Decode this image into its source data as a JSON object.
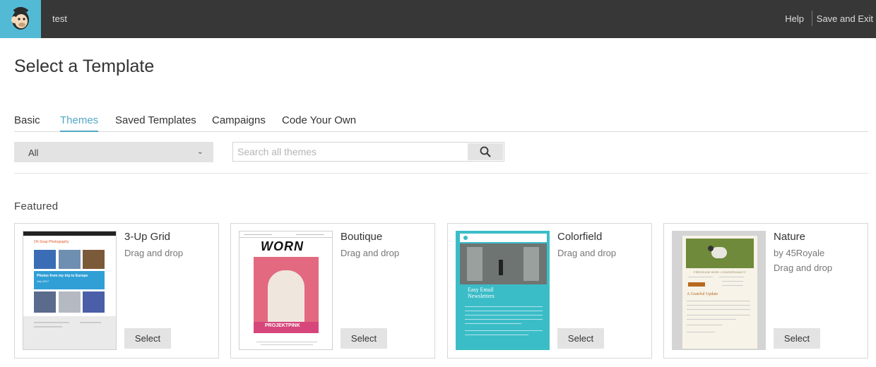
{
  "header": {
    "campaign_name": "test",
    "help_label": "Help",
    "save_exit_label": "Save and Exit"
  },
  "page": {
    "title": "Select a Template"
  },
  "tabs": [
    {
      "label": "Basic",
      "active": false
    },
    {
      "label": "Themes",
      "active": true
    },
    {
      "label": "Saved Templates",
      "active": false
    },
    {
      "label": "Campaigns",
      "active": false
    },
    {
      "label": "Code Your Own",
      "active": false
    }
  ],
  "filter": {
    "selected": "All"
  },
  "search": {
    "placeholder": "Search all themes",
    "value": ""
  },
  "featured": {
    "title": "Featured",
    "templates": [
      {
        "name": "3-Up Grid",
        "meta": [
          "Drag and drop"
        ],
        "select_label": "Select",
        "thumb_text": {
          "brand": "Oh Snap Photography",
          "headline": "Photos from my trip to Europe",
          "date": "July 2017"
        }
      },
      {
        "name": "Boutique",
        "meta": [
          "Drag and drop"
        ],
        "select_label": "Select",
        "thumb_text": {
          "logo": "WORN",
          "banner": "PROJEKTPINK"
        }
      },
      {
        "name": "Colorfield",
        "meta": [
          "Drag and drop"
        ],
        "select_label": "Select",
        "thumb_text": {
          "headline": "Easy Email Newsletters"
        }
      },
      {
        "name": "Nature",
        "meta": [
          "by 45Royale",
          "Drag and drop"
        ],
        "select_label": "Select",
        "thumb_text": {
          "headline": "A Grateful Update",
          "org": "FREEDOM BIRD CONSERVANCY"
        }
      }
    ]
  },
  "colors": {
    "topbar": "#373737",
    "logo_bg": "#52bad5",
    "accent": "#52a7c6",
    "button_bg": "#e3e3e3"
  }
}
